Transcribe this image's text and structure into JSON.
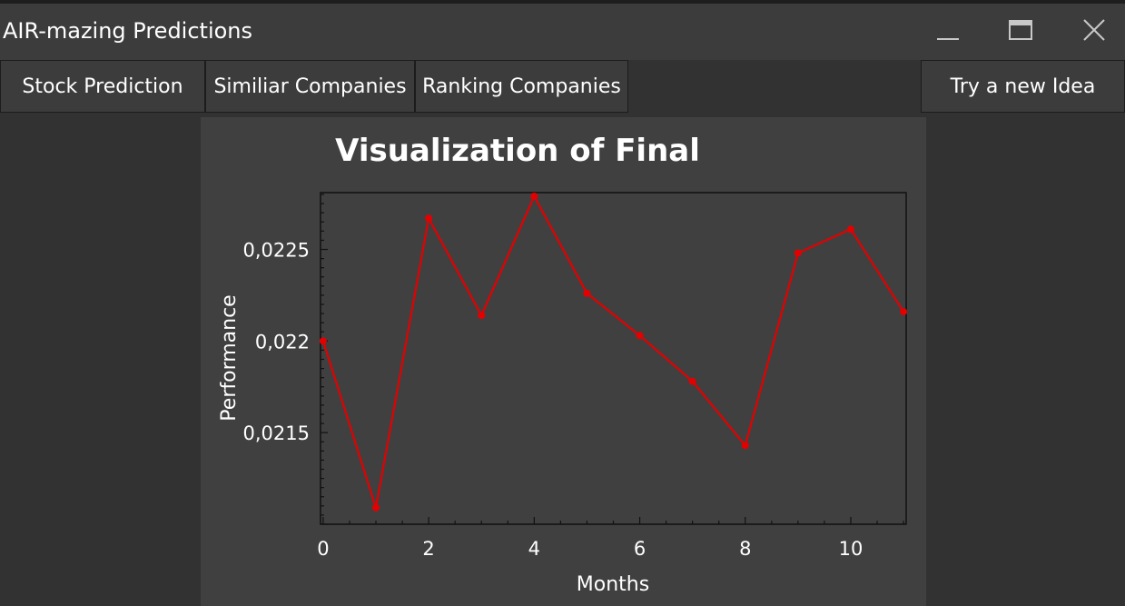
{
  "window": {
    "title": "AIR-mazing Predictions",
    "controls": [
      "minimize-icon",
      "maximize-icon",
      "close-icon"
    ]
  },
  "tabs": [
    {
      "label": "Stock Prediction"
    },
    {
      "label": "Similiar Companies"
    },
    {
      "label": "Ranking Companies"
    }
  ],
  "new_idea_button": {
    "label": "Try a new Idea"
  },
  "colors": {
    "series": "#e30000",
    "panel": "#404040",
    "plot_background": "#404040",
    "window_background": "#323232"
  },
  "chart_data": {
    "type": "line",
    "title": "Visualization of Final",
    "xlabel": "Months",
    "ylabel": "Performance",
    "x": [
      0,
      1,
      2,
      3,
      4,
      5,
      6,
      7,
      8,
      9,
      10,
      11
    ],
    "series": [
      {
        "values": [
          0.022,
          0.02109,
          0.02267,
          0.02214,
          0.02279,
          0.02226,
          0.02203,
          0.02178,
          0.02143,
          0.02248,
          0.02261,
          0.02216
        ]
      }
    ],
    "xlim": [
      -0.05,
      11.05
    ],
    "ylim": [
      0.021,
      0.02281
    ],
    "xticks": [
      0,
      2,
      4,
      6,
      8,
      10
    ],
    "xtick_labels": [
      "0",
      "2",
      "4",
      "6",
      "8",
      "10"
    ],
    "yticks": [
      0.0215,
      0.022,
      0.0225
    ],
    "ytick_labels": [
      "0,0215",
      "0,022",
      "0,0225"
    ],
    "grid": true,
    "legend": "none"
  }
}
